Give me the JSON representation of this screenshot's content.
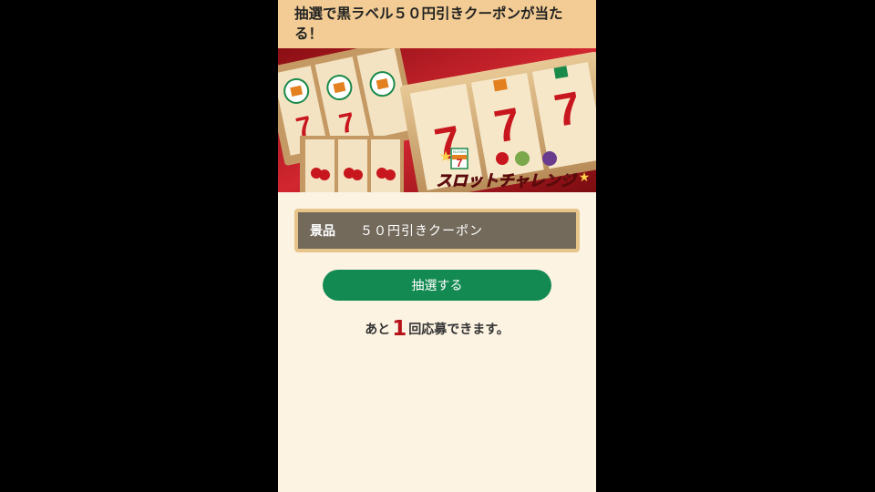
{
  "header": {
    "title": "抽選で黒ラベル５０円引きクーポンが当たる！"
  },
  "banner": {
    "text_seven": "7",
    "text_eleven": "ELEVEN",
    "title": "スロットチャレンジ"
  },
  "prize": {
    "label": "景品",
    "value": "５０円引きクーポン"
  },
  "draw_button": {
    "label": "抽選する"
  },
  "remaining": {
    "prefix": "あと",
    "count": "1",
    "suffix": "回応募できます。"
  },
  "colors": {
    "accent": "#138a52",
    "header_bg": "#f2cc94",
    "count_red": "#b5121b"
  }
}
